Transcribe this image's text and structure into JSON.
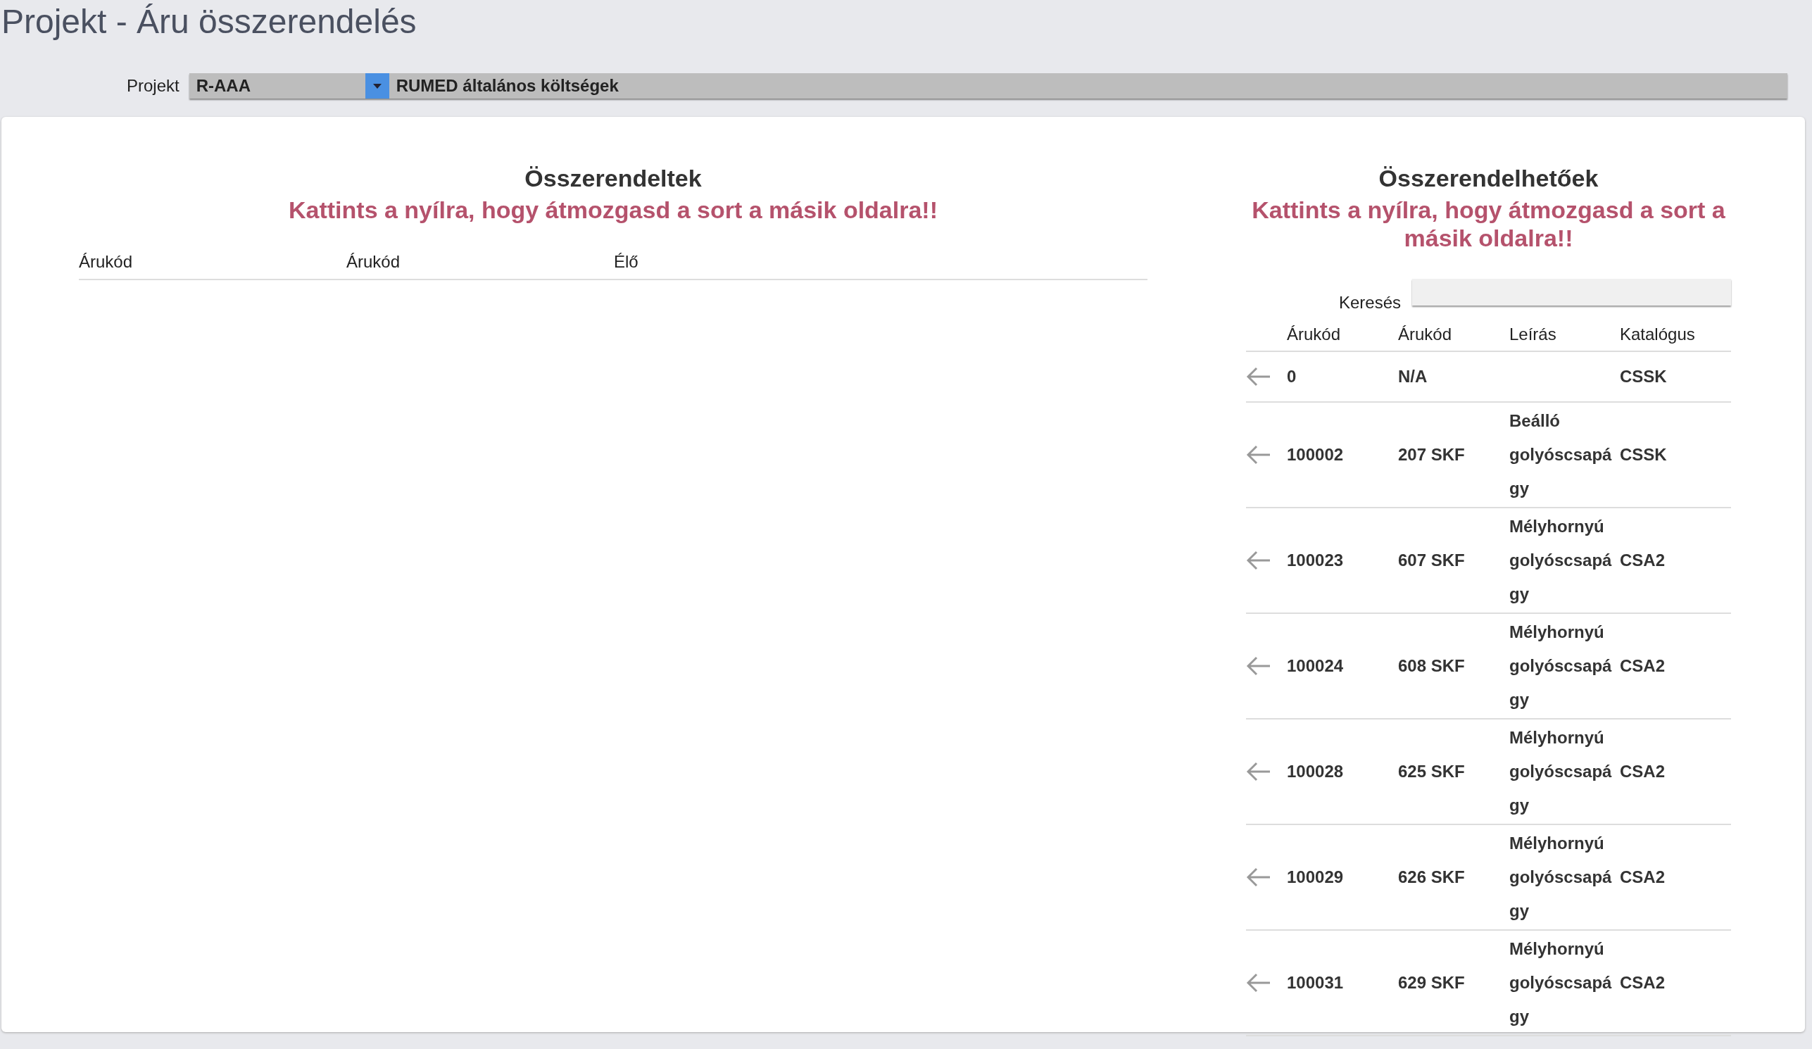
{
  "page_title": "Projekt - Áru összerendelés",
  "project": {
    "label": "Projekt",
    "code": "R-AAA",
    "name": "RUMED általános költségek"
  },
  "assigned": {
    "title": "Összerendeltek",
    "hint": "Kattints a nyílra, hogy átmozgasd a sort a másik oldalra!!",
    "columns": [
      "Árukód",
      "Árukód",
      "Élő"
    ]
  },
  "available": {
    "title": "Összerendelhetőek",
    "hint": "Kattints a nyílra, hogy átmozgasd a sort a másik oldalra!!",
    "search": {
      "label": "Keresés"
    },
    "columns": [
      "Árukód",
      "Árukód",
      "Leírás",
      "Katalógus"
    ],
    "rows": [
      {
        "code": "0",
        "code2": "N/A",
        "description": "",
        "catalog": "CSSK"
      },
      {
        "code": "100002",
        "code2": "207 SKF",
        "description": "Beálló golyóscsapágy",
        "catalog": "CSSK"
      },
      {
        "code": "100023",
        "code2": "607 SKF",
        "description": "Mélyhornyú golyóscsapágy",
        "catalog": "CSA2"
      },
      {
        "code": "100024",
        "code2": "608 SKF",
        "description": "Mélyhornyú golyóscsapágy",
        "catalog": "CSA2"
      },
      {
        "code": "100028",
        "code2": "625 SKF",
        "description": "Mélyhornyú golyóscsapágy",
        "catalog": "CSA2"
      },
      {
        "code": "100029",
        "code2": "626 SKF",
        "description": "Mélyhornyú golyóscsapágy",
        "catalog": "CSA2"
      },
      {
        "code": "100031",
        "code2": "629 SKF",
        "description": "Mélyhornyú golyóscsapágy",
        "catalog": "CSA2"
      }
    ]
  }
}
